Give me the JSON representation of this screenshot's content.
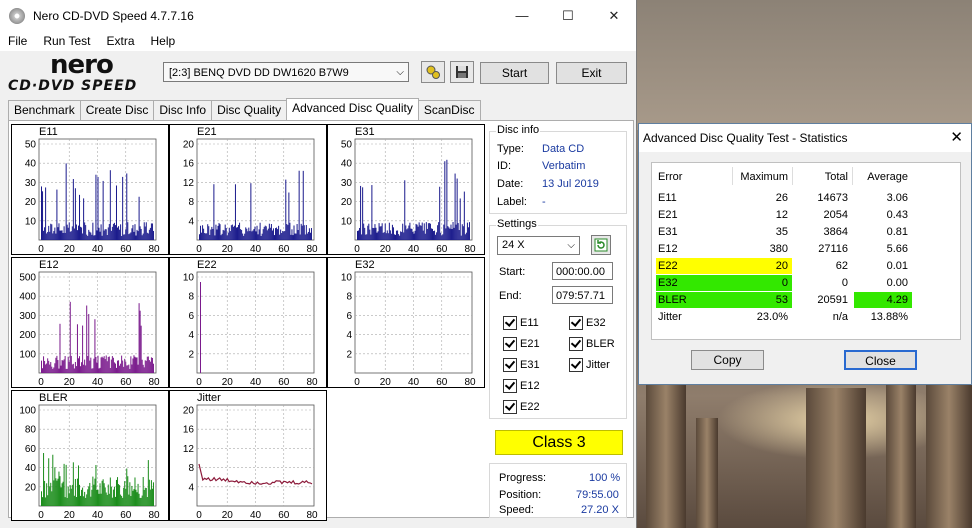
{
  "app": {
    "title": "Nero CD-DVD Speed 4.7.7.16"
  },
  "titlebar": {
    "minimize": "—",
    "maximize": "☐",
    "close": "✕"
  },
  "menu": [
    {
      "label": "File"
    },
    {
      "label": "Run Test"
    },
    {
      "label": "Extra"
    },
    {
      "label": "Help"
    }
  ],
  "logo": {
    "line1": "nero",
    "line2": "CD·DVD SPEED"
  },
  "toolbar": {
    "drive": "[2:3]   BENQ DVD DD DW1620 B7W9",
    "start_label": "Start",
    "exit_label": "Exit",
    "drive_arrow": "⌵"
  },
  "tabs": [
    {
      "label": "Benchmark"
    },
    {
      "label": "Create Disc"
    },
    {
      "label": "Disc Info"
    },
    {
      "label": "Disc Quality"
    },
    {
      "label": "Advanced Disc Quality"
    },
    {
      "label": "ScanDisc"
    }
  ],
  "graphs": [
    {
      "name": "E11",
      "yticks": [
        "50",
        "40",
        "30",
        "20",
        "10"
      ],
      "xticks": [
        "0",
        "20",
        "40",
        "60",
        "80"
      ],
      "color": "#1a1a8c"
    },
    {
      "name": "E21",
      "yticks": [
        "20",
        "16",
        "12",
        "8",
        "4"
      ],
      "xticks": [
        "0",
        "20",
        "40",
        "60",
        "80"
      ],
      "color": "#1a1a8c"
    },
    {
      "name": "E31",
      "yticks": [
        "50",
        "40",
        "30",
        "20",
        "10"
      ],
      "xticks": [
        "0",
        "20",
        "40",
        "60",
        "80"
      ],
      "color": "#1a1a8c"
    },
    {
      "name": "E12",
      "yticks": [
        "500",
        "400",
        "300",
        "200",
        "100"
      ],
      "xticks": [
        "0",
        "20",
        "40",
        "60",
        "80"
      ],
      "color": "#7a1a8c"
    },
    {
      "name": "E22",
      "yticks": [
        "10",
        "8",
        "6",
        "4",
        "2"
      ],
      "xticks": [
        "0",
        "20",
        "40",
        "60",
        "80"
      ],
      "color": "#7a1a8c"
    },
    {
      "name": "E32",
      "yticks": [
        "10",
        "8",
        "6",
        "4",
        "2"
      ],
      "xticks": [
        "0",
        "20",
        "40",
        "60",
        "80"
      ],
      "color": "#7a1a8c"
    },
    {
      "name": "BLER",
      "yticks": [
        "100",
        "80",
        "60",
        "40",
        "20"
      ],
      "xticks": [
        "0",
        "20",
        "40",
        "60",
        "80"
      ],
      "color": "#1a8c1a"
    },
    {
      "name": "Jitter",
      "yticks": [
        "20",
        "16",
        "12",
        "8",
        "4"
      ],
      "xticks": [
        "0",
        "20",
        "40",
        "60",
        "80"
      ],
      "color": "#8c1a3a"
    }
  ],
  "disc_info": {
    "title": "Disc info",
    "type_label": "Type:",
    "type": "Data CD",
    "id_label": "ID:",
    "id": "Verbatim",
    "date_label": "Date:",
    "date": "13 Jul 2019",
    "label_label": "Label:",
    "label": "-"
  },
  "settings": {
    "title": "Settings",
    "speed": "24 X",
    "start_label": "Start:",
    "start": "000:00.00",
    "end_label": "End:",
    "end": "079:57.71",
    "checks": [
      {
        "label": "E11"
      },
      {
        "label": "E32"
      },
      {
        "label": "E21"
      },
      {
        "label": "BLER"
      },
      {
        "label": "E31"
      },
      {
        "label": "Jitter"
      },
      {
        "label": "E12"
      },
      {
        "label": "E22"
      }
    ]
  },
  "class_label": "Class 3",
  "progress": {
    "progress_label": "Progress:",
    "progress": "100 %",
    "position_label": "Position:",
    "position": "79:55.00",
    "speed_label": "Speed:",
    "speed": "27.20 X"
  },
  "dialog": {
    "title": "Advanced Disc Quality Test - Statistics",
    "close_x": "✕",
    "headers": {
      "error": "Error",
      "maximum": "Maximum",
      "total": "Total",
      "average": "Average"
    },
    "rows": [
      {
        "error": "E11",
        "maximum": "26",
        "total": "14673",
        "average": "3.06"
      },
      {
        "error": "E21",
        "maximum": "12",
        "total": "2054",
        "average": "0.43"
      },
      {
        "error": "E31",
        "maximum": "35",
        "total": "3864",
        "average": "0.81"
      },
      {
        "error": "E12",
        "maximum": "380",
        "total": "27116",
        "average": "5.66"
      },
      {
        "error": "E22",
        "maximum": "20",
        "total": "62",
        "average": "0.01"
      },
      {
        "error": "E32",
        "maximum": "0",
        "total": "0",
        "average": "0.00"
      },
      {
        "error": "BLER",
        "maximum": "53",
        "total": "20591",
        "average": "4.29"
      },
      {
        "error": "Jitter",
        "maximum": "23.0%",
        "total": "n/a",
        "average": "13.88%"
      }
    ],
    "copy_label": "Copy",
    "close_label": "Close",
    "colors": {
      "yellow": "#ffff00",
      "green": "#33e800"
    }
  }
}
